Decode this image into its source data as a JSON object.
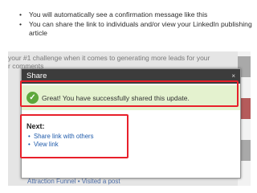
{
  "instructions": {
    "bullets": [
      "You will automatically see a confirmation message like this",
      "You can share the link to individuals and/or view your LinkedIn publishing article"
    ]
  },
  "background": {
    "line1": "your #1 challenge when it comes to generating more leads for your",
    "line2": "r comments",
    "bottom_text": "Attraction Funnel • Visited a post"
  },
  "dialog": {
    "title": "Share",
    "close_icon": "×",
    "success_message": "Great! You have successfully shared this update.",
    "next_heading": "Next:",
    "links": [
      "Share link with others",
      "View link"
    ]
  },
  "colors": {
    "highlight": "#e8202b",
    "header_bg": "#3c3c3c",
    "success_bg": "#e4f2cf",
    "link": "#1f5bab"
  },
  "icons": {
    "success": "check-circle-icon",
    "close": "close-icon"
  }
}
